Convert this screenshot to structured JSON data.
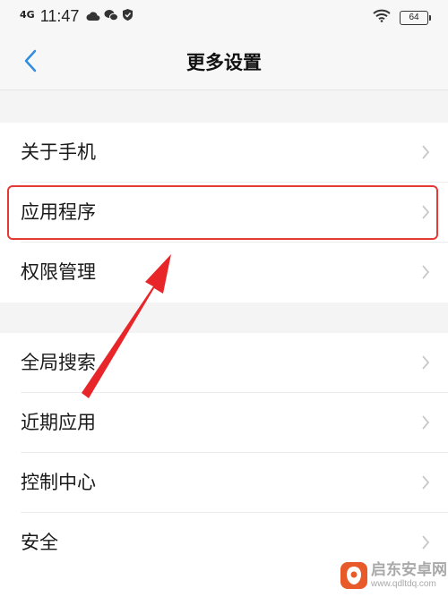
{
  "status_bar": {
    "network": "4G",
    "time": "11:47",
    "battery": "64"
  },
  "header": {
    "title": "更多设置",
    "back_icon": "chevron-left-icon"
  },
  "group1": {
    "items": [
      {
        "label": "关于手机"
      },
      {
        "label": "应用程序"
      },
      {
        "label": "权限管理"
      }
    ]
  },
  "group2": {
    "items": [
      {
        "label": "全局搜索"
      },
      {
        "label": "近期应用"
      },
      {
        "label": "控制中心"
      },
      {
        "label": "安全"
      }
    ]
  },
  "annotation": {
    "highlighted_item": "应用程序",
    "color": "#e53935"
  },
  "watermark": {
    "name": "启东安卓网",
    "url": "www.qdltdq.com"
  },
  "colors": {
    "accent": "#2f8ee0",
    "annotation_red": "#e53935"
  }
}
